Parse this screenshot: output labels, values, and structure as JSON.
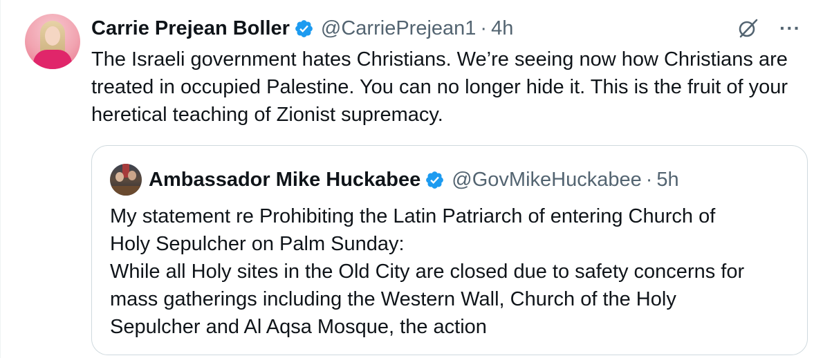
{
  "tweet": {
    "author_name": "Carrie Prejean Boller",
    "handle": "@CarriePrejean1",
    "separator": "·",
    "time": "4h",
    "more_label": "···",
    "text": "The Israeli government hates Christians. We’re seeing now how Christians are treated in occupied Palestine. You can no longer hide it. This is the fruit of your heretical teaching of Zionist supremacy."
  },
  "quoted": {
    "author_name": "Ambassador Mike Huckabee",
    "handle": "@GovMikeHuckabee",
    "separator": "·",
    "time": "5h",
    "lines": [
      "My statement re Prohibiting the Latin Patriarch of entering Church of",
      "Holy Sepulcher on Palm Sunday:",
      "While all Holy sites in the Old City are closed due to safety concerns for",
      "mass gatherings including the Western Wall, Church of the Holy",
      "Sepulcher and Al Aqsa Mosque, the action"
    ]
  },
  "icons": {
    "verified": "verified-badge-icon",
    "grok": "grok-icon",
    "more": "more-icon"
  },
  "colors": {
    "verified_blue": "#1d9bf0",
    "secondary_text": "#536471",
    "border": "#cfd9de"
  }
}
